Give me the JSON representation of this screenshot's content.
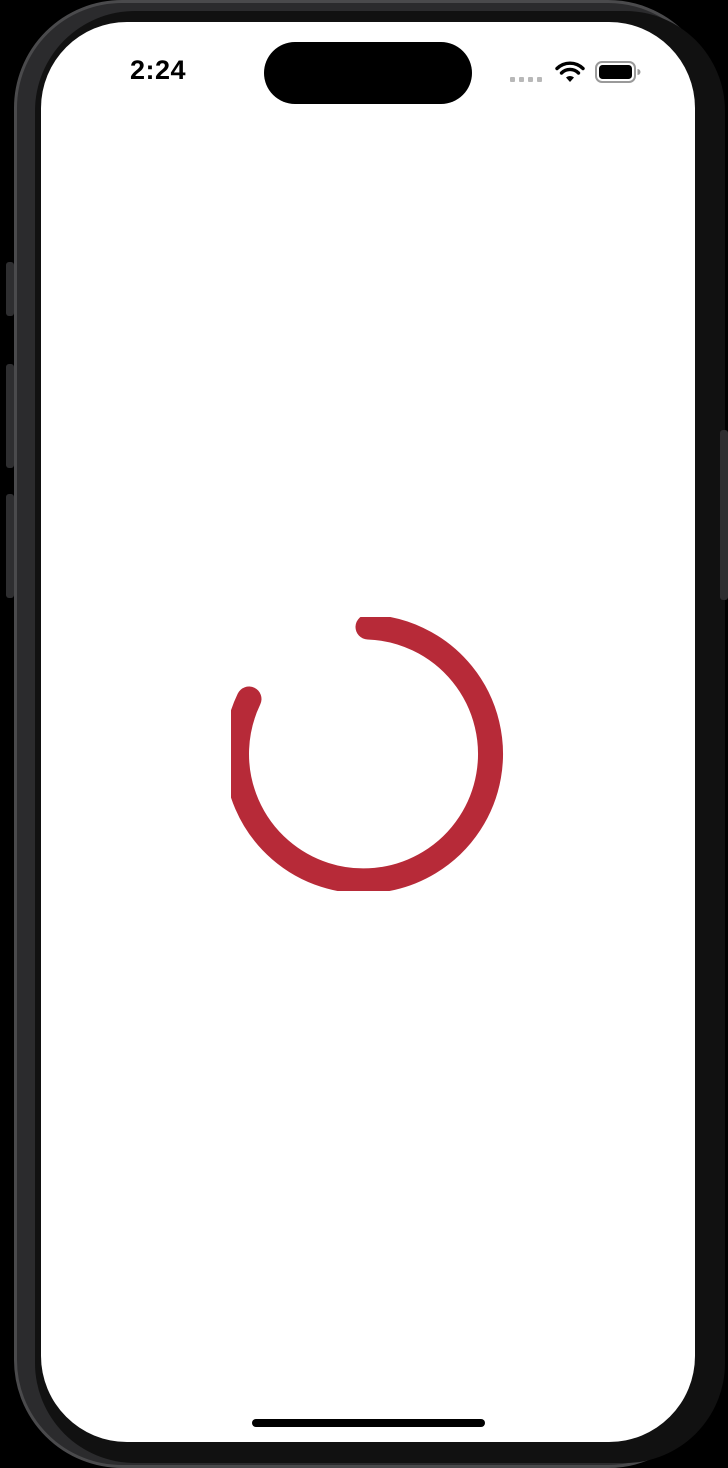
{
  "status_bar": {
    "time": "2:24",
    "signal_icon": "cellular-signal-dots",
    "wifi_icon": "wifi-icon",
    "battery_icon": "battery-icon"
  },
  "loading_spinner": {
    "icon": "loading-spinner-icon",
    "color": "#B72A38"
  },
  "colors": {
    "screen_background": "#FFFFFF",
    "device_frame": "#2B2B2D"
  }
}
